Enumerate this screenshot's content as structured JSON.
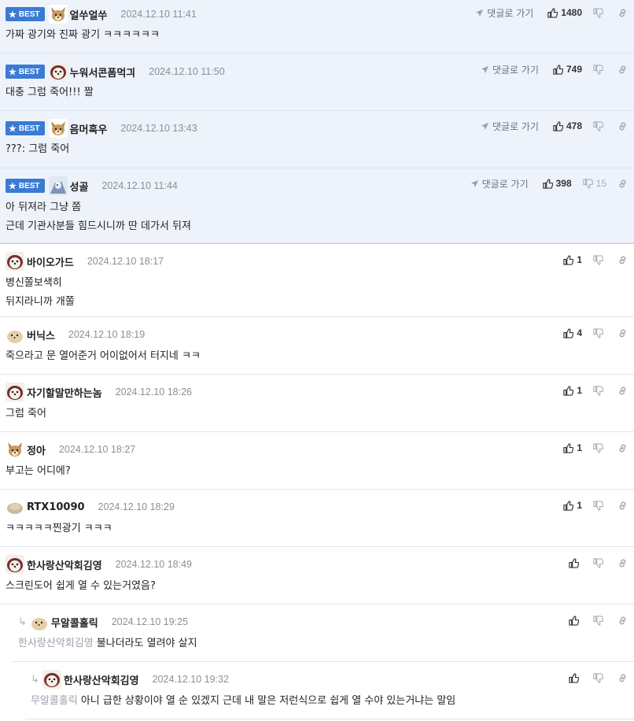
{
  "best_badge": "BEST",
  "goto_label": "댓글로 가기",
  "comments": [
    {
      "nick": "얼쑤얼쑤",
      "date": "2024.12.10 11:41",
      "lines": [
        "가짜 광기와 진짜 광기 ㅋㅋㅋㅋㅋㅋ"
      ],
      "likes": "1480",
      "dislikes": ""
    },
    {
      "nick": "누워서콘폼먹긔",
      "date": "2024.12.10 11:50",
      "lines": [
        "대충 그럼 죽어!!! 짤"
      ],
      "likes": "749",
      "dislikes": ""
    },
    {
      "nick": "음머흑우",
      "date": "2024.12.10 13:43",
      "lines": [
        "???: 그럼 죽어"
      ],
      "likes": "478",
      "dislikes": ""
    },
    {
      "nick": "성골",
      "date": "2024.12.10 11:44",
      "lines": [
        "아 뒤져라 그냥 쫌",
        "근데 기관사분들 힘드시니까 딴 데가서 뒤져"
      ],
      "likes": "398",
      "dislikes": "15"
    },
    {
      "nick": "바이오가드",
      "date": "2024.12.10 18:17",
      "lines": [
        "병신쫄보색히",
        "뒤지라니까 개쫄"
      ],
      "likes": "1",
      "dislikes": ""
    },
    {
      "nick": "버닉스",
      "date": "2024.12.10 18:19",
      "lines": [
        "죽으라고 문 열어준거 어이없어서 터지네 ㅋㅋ"
      ],
      "likes": "4",
      "dislikes": ""
    },
    {
      "nick": "자기할말만하는놈",
      "date": "2024.12.10 18:26",
      "lines": [
        "그럼 죽어"
      ],
      "likes": "1",
      "dislikes": ""
    },
    {
      "nick": "정아",
      "date": "2024.12.10 18:27",
      "lines": [
        "부고는 어디에?"
      ],
      "likes": "1",
      "dislikes": ""
    },
    {
      "nick": "RTX10090",
      "date": "2024.12.10 18:29",
      "lines": [
        "ㅋㅋㅋㅋㅋ찐광기 ㅋㅋㅋ"
      ],
      "likes": "1",
      "dislikes": ""
    },
    {
      "nick": "한사랑산악회김영",
      "date": "2024.12.10 18:49",
      "lines": [
        "스크린도어 쉽게 열 수 있는거였음?"
      ],
      "likes": "",
      "dislikes": ""
    },
    {
      "nick": "무알콜홀릭",
      "date": "2024.12.10 19:25",
      "mention": "한사랑산악회김영",
      "lines": [
        "불나더라도 열려야 살지"
      ],
      "likes": "",
      "dislikes": ""
    },
    {
      "nick": "한사랑산악회김영",
      "date": "2024.12.10 19:32",
      "mention": "무알콜홀릭",
      "lines": [
        "아니 급한 상황이야 열 순 있겠지 근데 내 말은 저런식으로 쉽게 열 수야 있는거냐는 말임"
      ],
      "likes": "",
      "dislikes": ""
    }
  ]
}
